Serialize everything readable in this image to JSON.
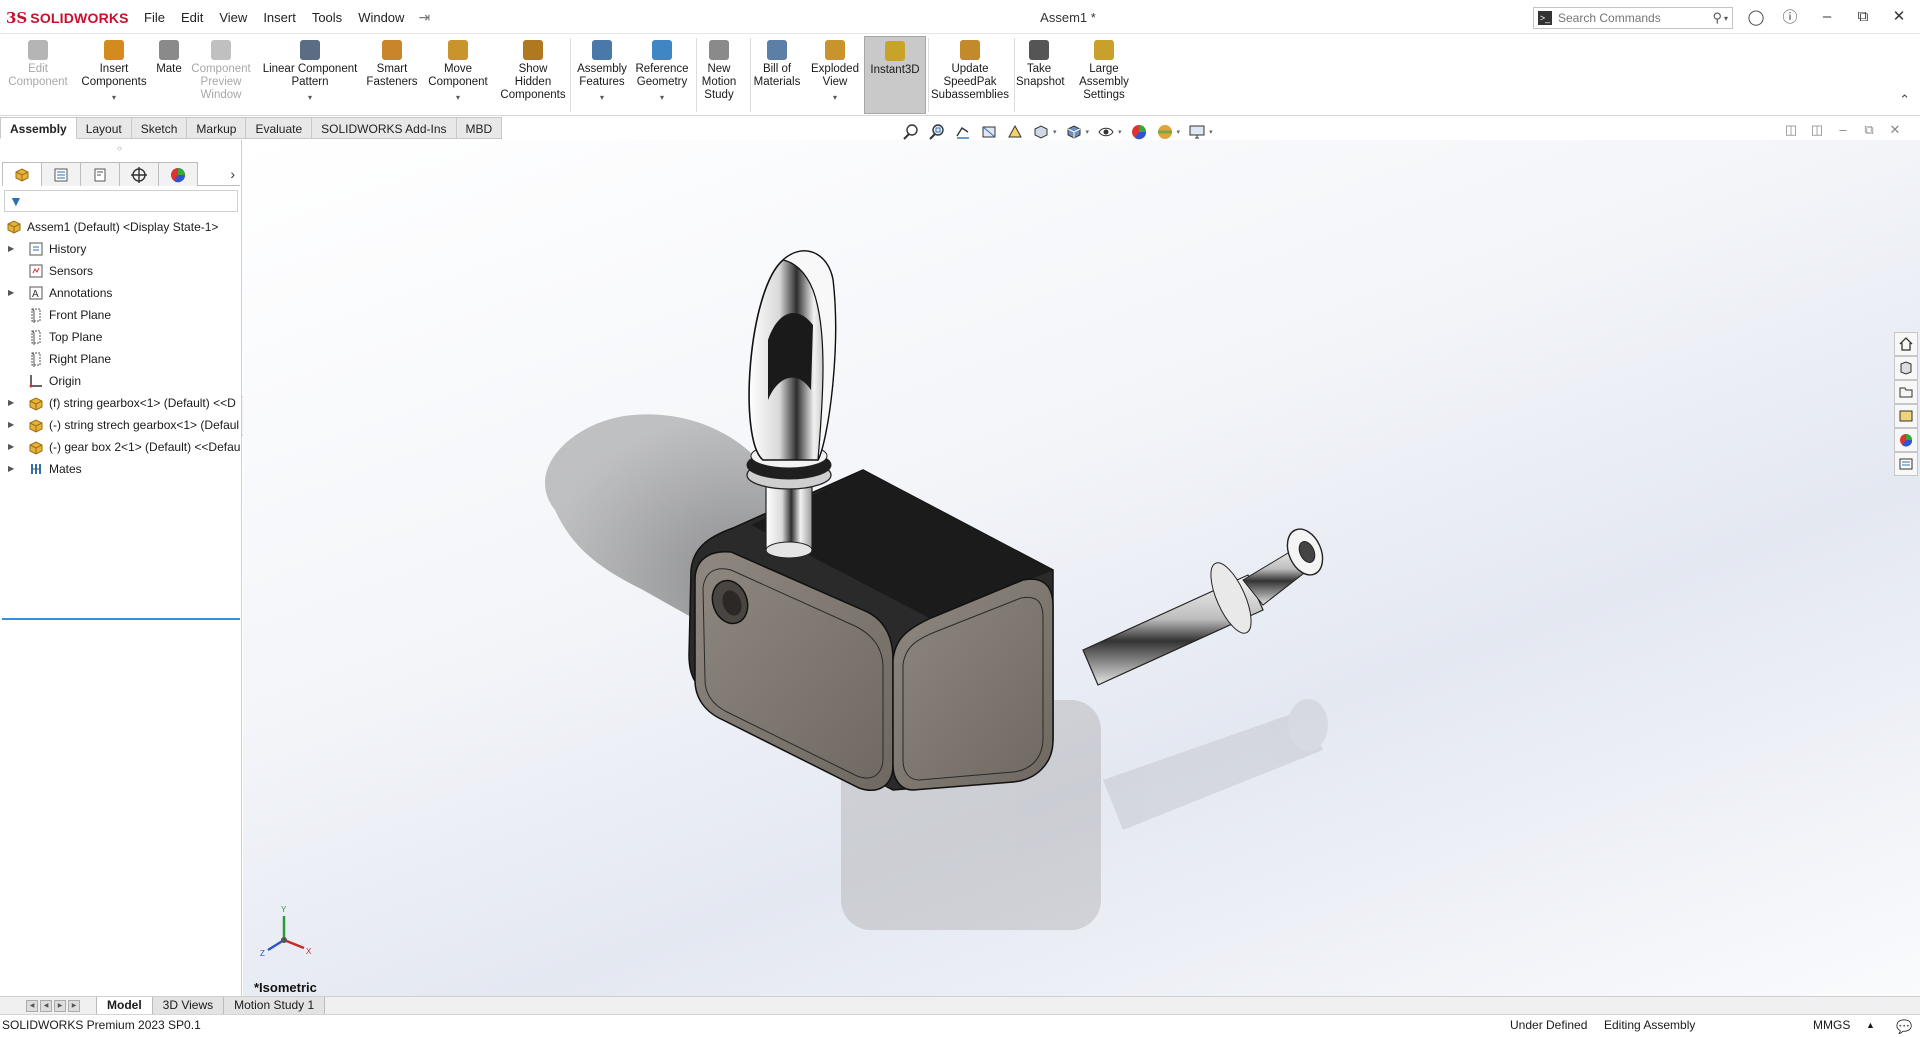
{
  "app": {
    "logo_prefix": "3S",
    "logo_name": "SOLIDWORKS",
    "document_title": "Assem1 *"
  },
  "menu": [
    "File",
    "Edit",
    "View",
    "Insert",
    "Tools",
    "Window"
  ],
  "search": {
    "placeholder": "Search Commands"
  },
  "ribbon": [
    {
      "lines": [
        "Edit",
        "Component"
      ],
      "disabled": true,
      "icon_color": "#b5b5b5",
      "icon": "edit-component-icon"
    },
    {
      "lines": [
        "Insert",
        "Components"
      ],
      "caret": true,
      "icon_color": "#d48b1e",
      "icon": "insert-components-icon"
    },
    {
      "lines": [
        "Mate"
      ],
      "icon_color": "#8a8a8a",
      "icon": "mate-icon"
    },
    {
      "lines": [
        "Component",
        "Preview",
        "Window"
      ],
      "disabled": true,
      "icon_color": "#c0c0c0",
      "icon": "component-preview-icon"
    },
    {
      "lines": [
        "Linear Component",
        "Pattern"
      ],
      "caret": true,
      "icon_color": "#5a6d84",
      "icon": "linear-pattern-icon"
    },
    {
      "lines": [
        "Smart",
        "Fasteners"
      ],
      "icon_color": "#c9852a",
      "icon": "smart-fasteners-icon"
    },
    {
      "lines": [
        "Move",
        "Component"
      ],
      "caret": true,
      "icon_color": "#c8942b",
      "icon": "move-component-icon"
    },
    {
      "lines": [
        "Show",
        "Hidden",
        "Components"
      ],
      "icon_color": "#b0781f",
      "icon": "show-hidden-icon"
    },
    {
      "lines": [
        "Assembly",
        "Features"
      ],
      "caret": true,
      "icon_color": "#4a78a8",
      "icon": "assembly-features-icon"
    },
    {
      "lines": [
        "Reference",
        "Geometry"
      ],
      "caret": true,
      "icon_color": "#3e86c4",
      "icon": "reference-geometry-icon"
    },
    {
      "lines": [
        "New",
        "Motion",
        "Study"
      ],
      "icon_color": "#8a8a8a",
      "icon": "motion-study-icon"
    },
    {
      "lines": [
        "Bill of",
        "Materials"
      ],
      "icon_color": "#5b7fa6",
      "icon": "bom-icon"
    },
    {
      "lines": [
        "Exploded",
        "View"
      ],
      "caret": true,
      "icon_color": "#c8942b",
      "icon": "exploded-view-icon"
    },
    {
      "lines": [
        "Instant3D"
      ],
      "active": true,
      "icon_color": "#c8a32b",
      "icon": "instant3d-icon"
    },
    {
      "lines": [
        "Update",
        "SpeedPak",
        "Subassemblies"
      ],
      "icon_color": "#c28a2a",
      "icon": "speedpak-icon"
    },
    {
      "lines": [
        "Take",
        "Snapshot"
      ],
      "icon_color": "#555555",
      "icon": "camera-icon"
    },
    {
      "lines": [
        "Large",
        "Assembly",
        "Settings"
      ],
      "icon_color": "#c9a02b",
      "icon": "large-assembly-icon"
    }
  ],
  "tabs": [
    "Assembly",
    "Layout",
    "Sketch",
    "Markup",
    "Evaluate",
    "SOLIDWORKS Add-Ins",
    "MBD"
  ],
  "tree": [
    {
      "label": "Assem1 (Default) <Display State-1>",
      "icon": "assembly-icon",
      "level": 0,
      "expand": false
    },
    {
      "label": "History",
      "icon": "history-icon",
      "level": 1,
      "expand": true
    },
    {
      "label": "Sensors",
      "icon": "sensors-icon",
      "level": 1,
      "expand": false
    },
    {
      "label": "Annotations",
      "icon": "annotations-icon",
      "level": 1,
      "expand": true
    },
    {
      "label": "Front Plane",
      "icon": "plane-icon",
      "level": 1,
      "expand": false
    },
    {
      "label": "Top Plane",
      "icon": "plane-icon",
      "level": 1,
      "expand": false
    },
    {
      "label": "Right Plane",
      "icon": "plane-icon",
      "level": 1,
      "expand": false
    },
    {
      "label": "Origin",
      "icon": "origin-icon",
      "level": 1,
      "expand": false
    },
    {
      "label": "(f) string gearbox<1> (Default) <<D",
      "icon": "part-icon",
      "level": 1,
      "expand": true
    },
    {
      "label": "(-) string strech gearbox<1> (Defaul",
      "icon": "part-icon",
      "level": 1,
      "expand": true
    },
    {
      "label": "(-) gear box 2<1> (Default) <<Defau",
      "icon": "part-icon",
      "level": 1,
      "expand": true
    },
    {
      "label": "Mates",
      "icon": "mates-icon",
      "level": 1,
      "expand": true
    }
  ],
  "viewport": {
    "view_name": "*Isometric",
    "triad": {
      "x": "X",
      "y": "Y",
      "z": "Z"
    }
  },
  "bottom_tabs": [
    "Model",
    "3D Views",
    "Motion Study 1"
  ],
  "status": {
    "product": "SOLIDWORKS Premium 2023 SP0.1",
    "definition": "Under Defined",
    "mode": "Editing Assembly",
    "units": "MMGS"
  },
  "colors": {
    "brand": "#c8102e",
    "selection": "#3b8fd6"
  }
}
